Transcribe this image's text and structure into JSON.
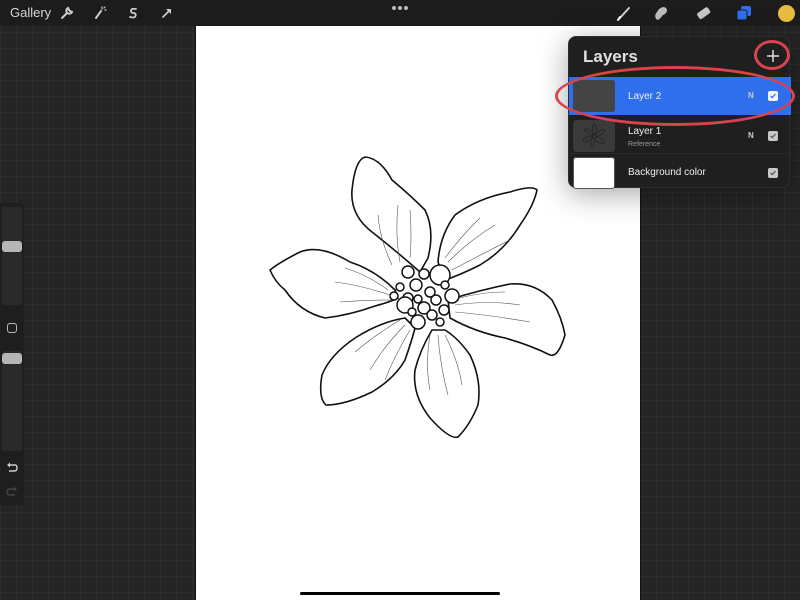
{
  "topbar": {
    "gallery_label": "Gallery",
    "left_tools": [
      {
        "name": "actions",
        "icon": "wrench-icon"
      },
      {
        "name": "adjustments",
        "icon": "magic-wand-icon"
      },
      {
        "name": "selection",
        "icon": "selection-s-icon"
      },
      {
        "name": "transform",
        "icon": "arrow-cursor-icon"
      }
    ],
    "more_icon": "ellipsis-icon",
    "right_tools": [
      {
        "name": "paint",
        "icon": "brush-icon"
      },
      {
        "name": "smudge",
        "icon": "smudge-finger-icon"
      },
      {
        "name": "erase",
        "icon": "eraser-icon"
      },
      {
        "name": "layers",
        "icon": "layers-icon",
        "active": true
      },
      {
        "name": "colors",
        "icon": "color-swatch-icon"
      }
    ],
    "accent_color": "#2f6fec",
    "current_color": "#e8bd3f"
  },
  "sidebar": {
    "brush_size": 0.75,
    "opacity": 1.0,
    "modify_label": "",
    "undo_icon": "undo-icon",
    "redo_icon": "redo-icon"
  },
  "layers_panel": {
    "title": "Layers",
    "add_icon": "plus-icon",
    "layers": [
      {
        "name": "Layer 2",
        "subtitle": "",
        "blend_mode": "N",
        "visible": true,
        "selected": true
      },
      {
        "name": "Layer 1",
        "subtitle": "Reference",
        "blend_mode": "N",
        "visible": true,
        "selected": false
      },
      {
        "name": "Background color",
        "subtitle": "",
        "blend_mode": "",
        "visible": true,
        "selected": false
      }
    ]
  },
  "annotations": {
    "color": "#d9434d",
    "highlighted": [
      "add-layer-button",
      "layer-2-row"
    ]
  }
}
